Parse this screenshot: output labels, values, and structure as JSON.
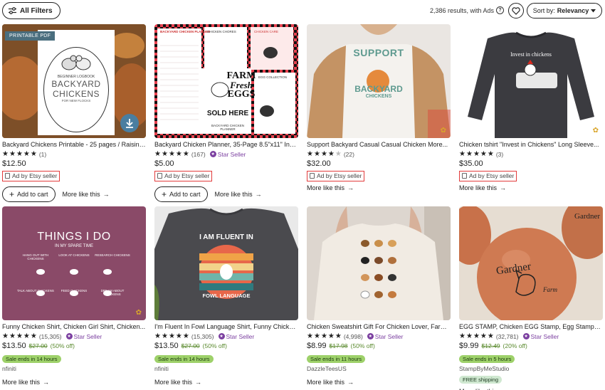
{
  "toolbar": {
    "all_filters": "All Filters",
    "results_text": "2,386 results, with Ads",
    "help_glyph": "?",
    "sort_prefix": "Sort by:",
    "sort_value": "Relevancy"
  },
  "labels": {
    "ad_by": "Ad by Etsy seller",
    "star_seller": "Star Seller",
    "add_to_cart": "Add to cart",
    "more_like_this": "More like this"
  },
  "row1": [
    {
      "title": "Backyard Chickens Printable - 25 pages / Raising Chickens...",
      "reviews": "(1)",
      "price": "$12.50",
      "tag": "PRINTABLE PDF",
      "thumb_text": [
        "BEGINNER LOGBOOK",
        "BACKYARD",
        "CHICKENS",
        "FOR NEW FLOCKS"
      ]
    },
    {
      "title": "Backyard Chicken Planner, 35-Page 8.5\"x11\" Instant...",
      "reviews": "(167)",
      "price": "$5.00",
      "thumb_text": [
        "BACKYARD CHICKEN PLANNER",
        "FARM",
        "Fresh",
        "EGGS",
        "SOLD HERE",
        "CHICKEN CHORES",
        "CHICKEN CARE",
        "EGG COLLECTION",
        "BACKYARD CHICKEN PLANNER"
      ]
    },
    {
      "title": "Support Backyard Casual Casual Chicken More...",
      "reviews": "(22)",
      "price": "$32.00",
      "thumb_text": [
        "SUPPORT",
        "BACKYARD",
        "CHICKENS"
      ]
    },
    {
      "title": "Chicken tshirt \"Invest in Chickens\" Long Sleeve...",
      "reviews": "(3)",
      "price": "$35.00",
      "thumb_text": [
        "Invest in chickens"
      ]
    }
  ],
  "row2": [
    {
      "title": "Funny Chicken Shirt, Chicken Girl Shirt, Chicken...",
      "reviews": "(15,305)",
      "price": "$13.50",
      "orig": "$27.00",
      "off": "(50% off)",
      "sale": "Sale ends in 14 hours",
      "shop": "nfiniti",
      "thumb_text": [
        "THINGS I DO",
        "IN MY SPARE TIME",
        "HANG OUT WITH CHICKENS",
        "LOOK AT CHICKENS",
        "RESEARCH CHICKENS",
        "TALK ABOUT CHICKENS",
        "FEED CHICKENS",
        "DREAM ABOUT CHICKENS"
      ]
    },
    {
      "title": "I'm Fluent In Fowl Language Shirt, Funny Chicken...",
      "reviews": "(15,305)",
      "price": "$13.50",
      "orig": "$27.00",
      "off": "(50% off)",
      "sale": "Sale ends in 14 hours",
      "shop": "nfiniti",
      "thumb_text": [
        "I AM FLUENT IN",
        "FOWL LANGUAGE"
      ]
    },
    {
      "title": "Chicken Sweatshirt Gift For Chicken Lover, Farm...",
      "reviews": "(4,998)",
      "price": "$8.99",
      "orig": "$17.98",
      "off": "(50% off)",
      "sale": "Sale ends in 11 hours",
      "shop": "DazzleTeesUS"
    },
    {
      "title": "EGG STAMP, Chicken EGG Stamp, Egg Stamps, Egg...",
      "reviews": "(32,781)",
      "price": "$9.99",
      "orig": "$12.49",
      "off": "(20% off)",
      "sale": "Sale ends in 5 hours",
      "shop": "StampByMeStudio",
      "free_shipping": "FREE shipping",
      "thumb_text": [
        "Gardner",
        "Farm",
        "Gardner"
      ]
    }
  ],
  "colors": {
    "ad_outline": "#e23b3b",
    "star_seller": "#7b3fa0",
    "sale_badge": "#9ed16a",
    "discount": "#5a8a2e"
  }
}
